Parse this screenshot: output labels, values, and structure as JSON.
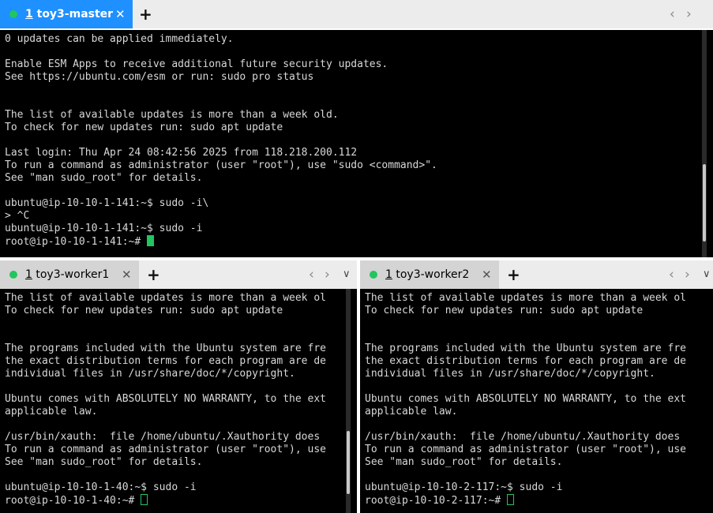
{
  "top": {
    "tab": {
      "number": "1",
      "title": "toy3-master"
    },
    "lines": [
      "0 updates can be applied immediately.",
      "",
      "Enable ESM Apps to receive additional future security updates.",
      "See https://ubuntu.com/esm or run: sudo pro status",
      "",
      "",
      "The list of available updates is more than a week old.",
      "To check for new updates run: sudo apt update",
      "",
      "Last login: Thu Apr 24 08:42:56 2025 from 118.218.200.112",
      "To run a command as administrator (user \"root\"), use \"sudo <command>\".",
      "See \"man sudo_root\" for details.",
      "",
      "ubuntu@ip-10-10-1-141:~$ sudo -i\\",
      "> ^C",
      "ubuntu@ip-10-10-1-141:~$ sudo -i"
    ],
    "prompt": "root@ip-10-10-1-141:~# "
  },
  "left": {
    "tab": {
      "number": "1",
      "title": "toy3-worker1"
    },
    "lines": [
      "The list of available updates is more than a week ol",
      "To check for new updates run: sudo apt update",
      "",
      "",
      "The programs included with the Ubuntu system are fre",
      "the exact distribution terms for each program are de",
      "individual files in /usr/share/doc/*/copyright.",
      "",
      "Ubuntu comes with ABSOLUTELY NO WARRANTY, to the ext",
      "applicable law.",
      "",
      "/usr/bin/xauth:  file /home/ubuntu/.Xauthority does",
      "To run a command as administrator (user \"root\"), use",
      "See \"man sudo_root\" for details.",
      "",
      "ubuntu@ip-10-10-1-40:~$ sudo -i"
    ],
    "prompt": "root@ip-10-10-1-40:~# "
  },
  "right": {
    "tab": {
      "number": "1",
      "title": "toy3-worker2"
    },
    "lines": [
      "The list of available updates is more than a week ol",
      "To check for new updates run: sudo apt update",
      "",
      "",
      "The programs included with the Ubuntu system are fre",
      "the exact distribution terms for each program are de",
      "individual files in /usr/share/doc/*/copyright.",
      "",
      "Ubuntu comes with ABSOLUTELY NO WARRANTY, to the ext",
      "applicable law.",
      "",
      "/usr/bin/xauth:  file /home/ubuntu/.Xauthority does",
      "To run a command as administrator (user \"root\"), use",
      "See \"man sudo_root\" for details.",
      "",
      "ubuntu@ip-10-10-2-117:~$ sudo -i"
    ],
    "prompt": "root@ip-10-10-2-117:~# "
  },
  "icons": {
    "close": "✕",
    "add": "+",
    "prev": "‹",
    "next": "›",
    "menu": "∨"
  },
  "colors": {
    "active_tab": "#1e90ff",
    "status_dot": "#22c55e",
    "cursor": "#22c55e",
    "terminal_bg": "#000000"
  }
}
